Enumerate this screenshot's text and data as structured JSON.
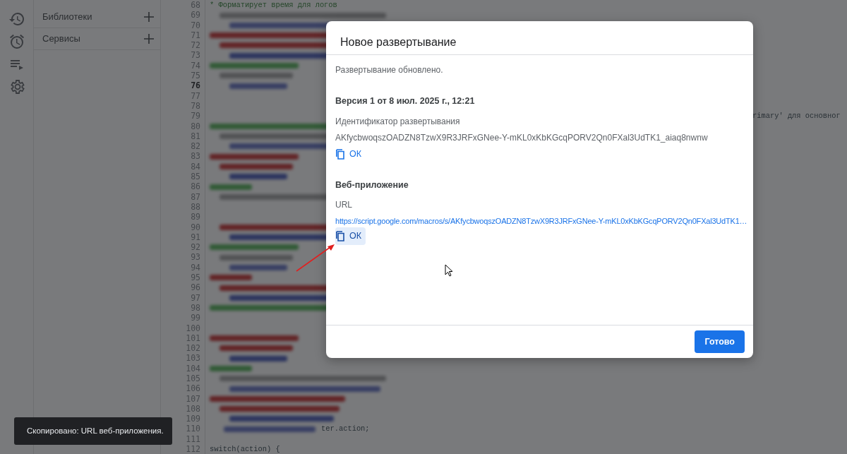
{
  "rail": [
    {
      "kind": "history"
    },
    {
      "kind": "alarm"
    },
    {
      "kind": "playlist"
    },
    {
      "kind": "settings"
    }
  ],
  "sidebar": {
    "items": [
      {
        "label": "Библиотеки"
      },
      {
        "label": "Сервисы"
      }
    ]
  },
  "editor": {
    "lines": [
      {
        "number": "68",
        "text": "* Форматирует время для логов",
        "active": false
      },
      {
        "number": "69",
        "active": false
      },
      {
        "number": "70",
        "active": false
      },
      {
        "number": "71",
        "active": false
      },
      {
        "number": "72",
        "active": false
      },
      {
        "number": "73",
        "active": false
      },
      {
        "number": "74",
        "active": false
      },
      {
        "number": "75",
        "active": false
      },
      {
        "number": "76",
        "active": true
      },
      {
        "number": "77",
        "active": false
      },
      {
        "number": "78",
        "active": false
      },
      {
        "number": "79",
        "text": "rimary' для основног",
        "kind": "tail",
        "active": false
      },
      {
        "number": "80",
        "active": false
      },
      {
        "number": "81",
        "active": false
      },
      {
        "number": "82",
        "active": false
      },
      {
        "number": "83",
        "active": false
      },
      {
        "number": "84",
        "active": false
      },
      {
        "number": "85",
        "active": false
      },
      {
        "number": "86",
        "active": false
      },
      {
        "number": "87",
        "active": false
      },
      {
        "number": "88",
        "active": false
      },
      {
        "number": "89",
        "active": false
      },
      {
        "number": "90",
        "active": false
      },
      {
        "number": "91",
        "active": false
      },
      {
        "number": "92",
        "active": false
      },
      {
        "number": "93",
        "active": false
      },
      {
        "number": "94",
        "active": false
      },
      {
        "number": "95",
        "active": false
      },
      {
        "number": "96",
        "active": false
      },
      {
        "number": "97",
        "active": false
      },
      {
        "number": "98",
        "active": false
      },
      {
        "number": "99",
        "active": false
      },
      {
        "number": "100",
        "active": false
      },
      {
        "number": "101",
        "active": false
      },
      {
        "number": "102",
        "active": false
      },
      {
        "number": "103",
        "active": false
      },
      {
        "number": "104",
        "active": false
      },
      {
        "number": "105",
        "active": false
      },
      {
        "number": "106",
        "active": false
      },
      {
        "number": "107",
        "active": false
      },
      {
        "number": "108",
        "active": false
      },
      {
        "number": "109",
        "active": false
      },
      {
        "number": "110",
        "text": "ter.action;",
        "kind": "mixed",
        "active": false
      },
      {
        "number": "111",
        "active": false
      },
      {
        "number": "112",
        "text": "switch(action) {",
        "active": false
      }
    ]
  },
  "dialog": {
    "title": "Новое развертывание",
    "status": "Развертывание обновлено.",
    "version": "Версия 1 от 8 июл. 2025 г., 12:21",
    "deployment_id": {
      "label": "Идентификатор развертывания",
      "value": "AKfycbwoqszOADZN8TzwX9R3JRFxGNee-Y-mKL0xKbKGcqPORV2Qn0FXal3UdTK1_aiaq8nwnw",
      "copy_button": {
        "label": "ОК",
        "highlighted": false
      }
    },
    "web_app": {
      "heading": "Веб-приложение",
      "label": "URL",
      "url": "https://script.google.com/macros/s/AKfycbwoqszOADZN8TzwX9R3JRFxGNee-Y-mKL0xKbKGcqPORV2Qn0FXal3UdTK1…",
      "copy_button": {
        "label": "ОК",
        "highlighted": true
      }
    },
    "done_button": "Готово"
  },
  "toast": "Скопировано: URL веб-приложения."
}
